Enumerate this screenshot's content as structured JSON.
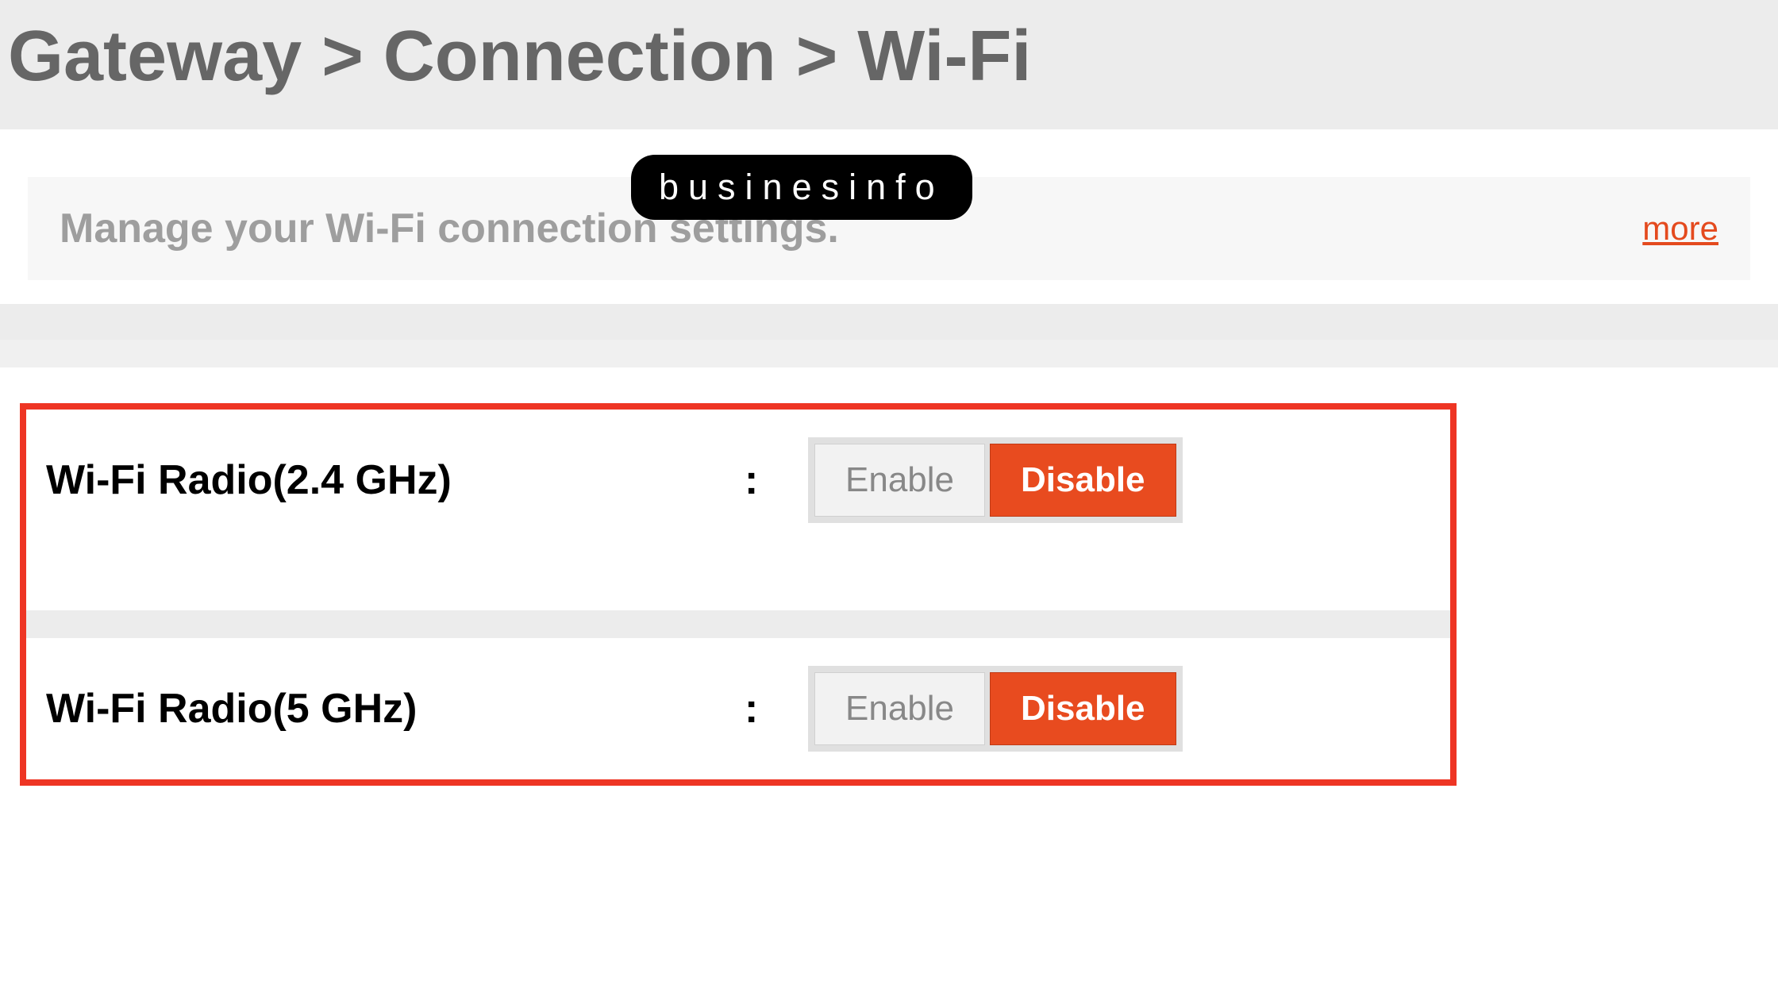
{
  "breadcrumb": {
    "text": "Gateway > Connection > Wi-Fi"
  },
  "watermark": "businesinfo",
  "subtitle": {
    "text": "Manage your Wi-Fi connection settings.",
    "more_label": "more"
  },
  "radios": [
    {
      "label": "Wi-Fi Radio(2.4 GHz)",
      "enable_label": "Enable",
      "disable_label": "Disable"
    },
    {
      "label": "Wi-Fi Radio(5 GHz)",
      "enable_label": "Enable",
      "disable_label": "Disable"
    }
  ]
}
